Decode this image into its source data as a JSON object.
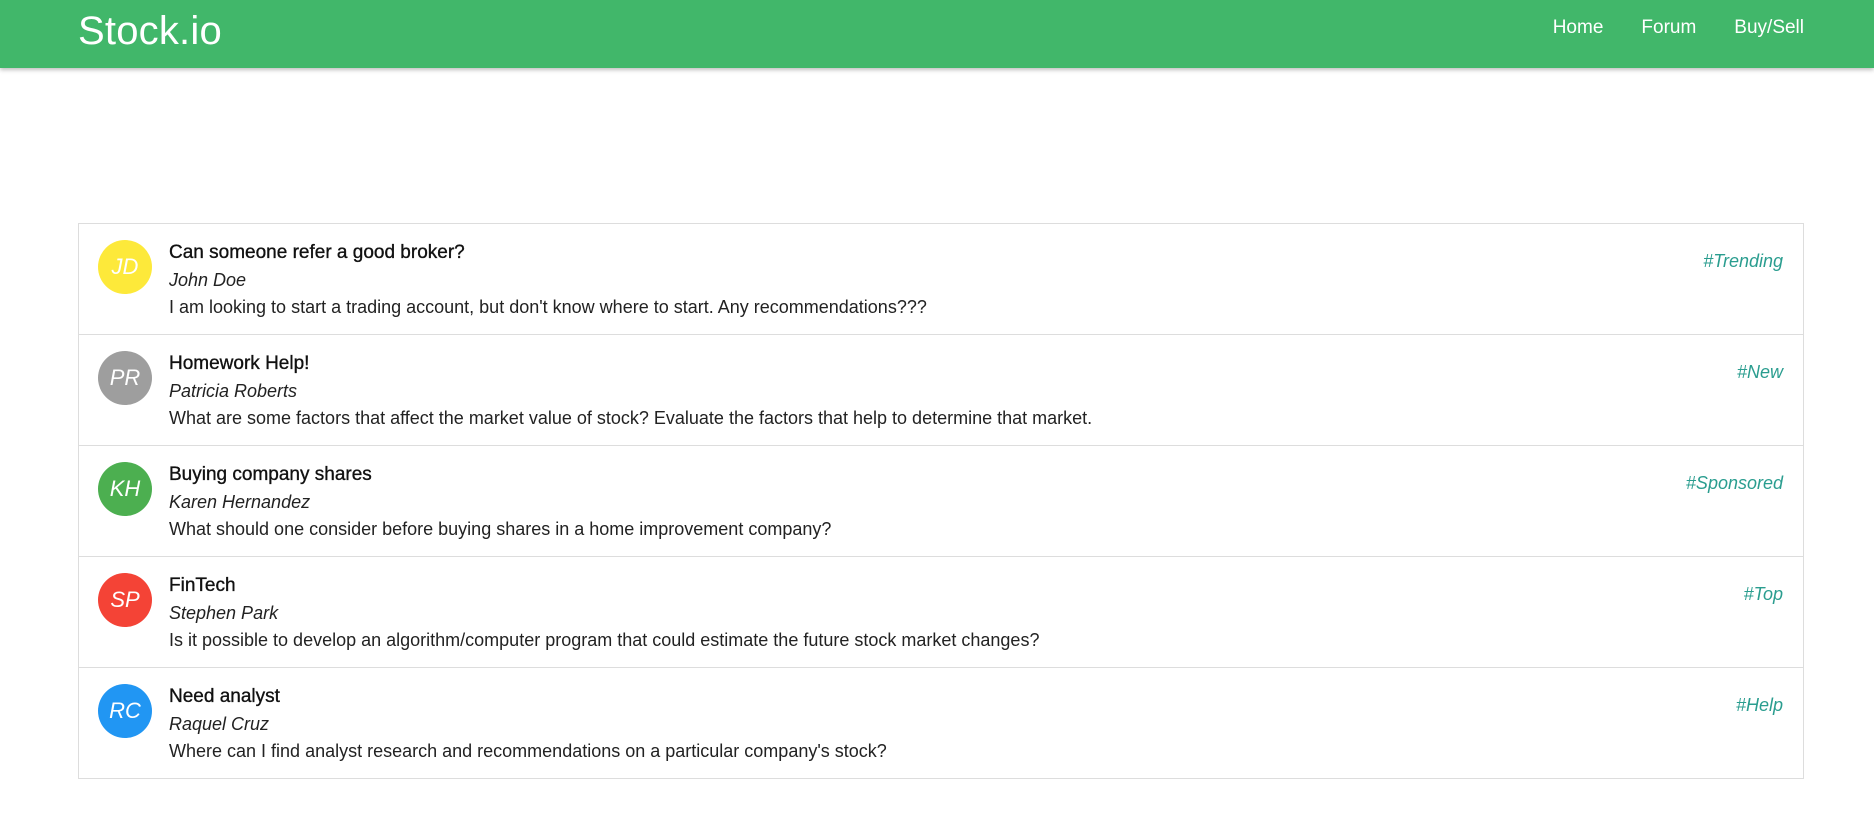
{
  "header": {
    "brand": "Stock.io",
    "nav": [
      {
        "label": "Home"
      },
      {
        "label": "Forum"
      },
      {
        "label": "Buy/Sell"
      }
    ],
    "color": "#41b76a"
  },
  "posts": [
    {
      "initials": "JD",
      "avatar_color": "#fde93a",
      "title": "Can someone refer a good broker?",
      "author": "John Doe",
      "text": "I am looking to start a trading account, but don't know where to start. Any recommendations???",
      "tag": "#Trending"
    },
    {
      "initials": "PR",
      "avatar_color": "#9e9e9e",
      "title": "Homework Help!",
      "author": "Patricia Roberts",
      "text": "What are some factors that affect the market value of stock? Evaluate the factors that help to determine that market.",
      "tag": "#New"
    },
    {
      "initials": "KH",
      "avatar_color": "#4caf50",
      "title": "Buying company shares",
      "author": "Karen Hernandez",
      "text": "What should one consider before buying shares in a home improvement company?",
      "tag": "#Sponsored"
    },
    {
      "initials": "SP",
      "avatar_color": "#f44336",
      "title": "FinTech",
      "author": "Stephen Park",
      "text": "Is it possible to develop an algorithm/computer program that could estimate the future stock market changes?",
      "tag": "#Top"
    },
    {
      "initials": "RC",
      "avatar_color": "#2196f3",
      "title": "Need analyst",
      "author": "Raquel Cruz",
      "text": "Where can I find analyst research and recommendations on a particular company's stock?",
      "tag": "#Help"
    }
  ],
  "tag_color": "#2a9d8f"
}
